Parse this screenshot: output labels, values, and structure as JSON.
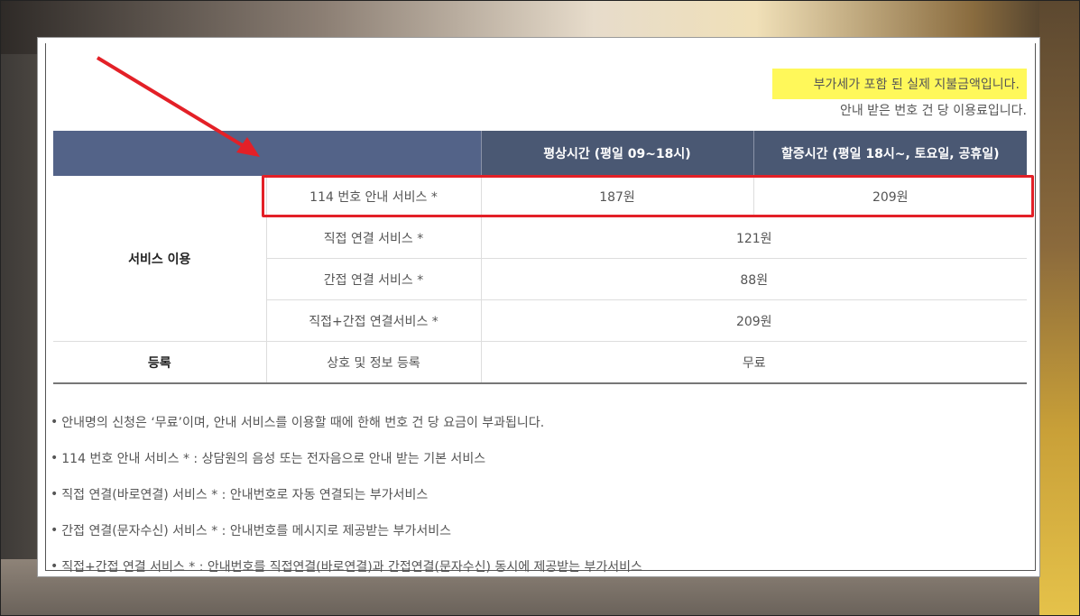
{
  "notice": {
    "vat": "부가세가 포함 된 실제 지불금액입니다.",
    "unit": "안내 받은 번호 건 당 이용료입니다."
  },
  "table": {
    "headers": [
      "평상시간 (평일 09~18시)",
      "할증시간 (평일 18시~, 토요일, 공휴일)"
    ],
    "group_service": "서비스 이용",
    "group_register": "등록",
    "rows": [
      {
        "name": "114 번호 안내 서비스 *",
        "normal": "187원",
        "surcharge": "209원"
      },
      {
        "name": "직접 연결 서비스 *",
        "price": "121원"
      },
      {
        "name": "간접 연결 서비스 *",
        "price": "88원"
      },
      {
        "name": "직접+간접 연결서비스 *",
        "price": "209원"
      },
      {
        "name": "상호 및 정보 등록",
        "price": "무료"
      }
    ]
  },
  "notes": [
    "안내명의 신청은 ‘무료’이며, 안내 서비스를 이용할 때에 한해 번호 건 당 요금이 부과됩니다.",
    "114 번호 안내 서비스 * : 상담원의 음성 또는 전자음으로 안내 받는 기본 서비스",
    "직접 연결(바로연결) 서비스 * : 안내번호로 자동 연결되는 부가서비스",
    "간접 연결(문자수신) 서비스 * : 안내번호를 메시지로 제공받는 부가서비스",
    "직접+간접 연결 서비스 * : 안내번호를 직접연결(바로연결)과 간접연결(문자수신) 동시에 제공받는 부가서비스"
  ],
  "colors": {
    "header": "#4a5873",
    "highlight": "#e32027",
    "notice_bg": "#fff85a"
  }
}
